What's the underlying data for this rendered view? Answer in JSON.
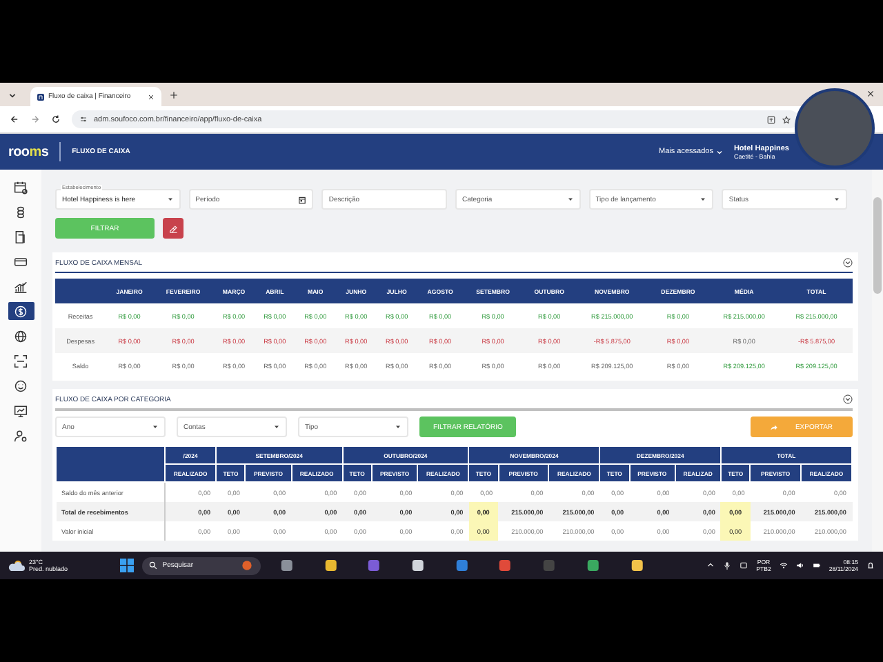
{
  "browser": {
    "tab_title": "Fluxo de caixa | Financeiro",
    "url": "adm.soufoco.com.br/financeiro/app/fluxo-de-caixa"
  },
  "header": {
    "logo": [
      {
        "text": "roo",
        "accent": false
      },
      {
        "text": "m",
        "accent": true
      },
      {
        "text": "s",
        "accent": false
      }
    ],
    "title": "FLUXO DE CAIXA",
    "menu": "Mais acessados",
    "hotel": "Hotel Happines",
    "location": "Caetité - Bahia"
  },
  "sidebar": {
    "items": [
      {
        "kind": "calendar",
        "selected": false
      },
      {
        "kind": "coins",
        "selected": false
      },
      {
        "kind": "document",
        "selected": false
      },
      {
        "kind": "card",
        "selected": false
      },
      {
        "kind": "chart",
        "selected": false
      },
      {
        "kind": "dollar",
        "selected": true
      },
      {
        "kind": "globe",
        "selected": false
      },
      {
        "kind": "scan",
        "selected": false
      },
      {
        "kind": "smile",
        "selected": false
      },
      {
        "kind": "monitor",
        "selected": false
      },
      {
        "kind": "user",
        "selected": false
      }
    ]
  },
  "filters": [
    {
      "kind": "select",
      "label": "Estabelecimento",
      "value": "Hotel Happiness is here"
    },
    {
      "kind": "date",
      "placeholder": "Período"
    },
    {
      "kind": "text",
      "placeholder": "Descrição"
    },
    {
      "kind": "select",
      "placeholder": "Categoria"
    },
    {
      "kind": "select",
      "placeholder": "Tipo de lançamento"
    },
    {
      "kind": "select",
      "placeholder": "Status"
    }
  ],
  "filter_button": "FILTRAR",
  "monthly": {
    "title": "FLUXO DE CAIXA MENSAL",
    "columns": [
      "JANEIRO",
      "FEVEREIRO",
      "MARÇO",
      "ABRIL",
      "MAIO",
      "JUNHO",
      "JULHO",
      "AGOSTO",
      "SETEMBRO",
      "OUTUBRO",
      "NOVEMBRO",
      "DEZEMBRO",
      "MÉDIA",
      "TOTAL"
    ],
    "rows": [
      {
        "label": "Receitas",
        "cells": [
          {
            "text": "R$ 0,00",
            "kind": "positive"
          },
          {
            "text": "R$ 0,00",
            "kind": "positive"
          },
          {
            "text": "R$ 0,00",
            "kind": "positive"
          },
          {
            "text": "R$ 0,00",
            "kind": "positive"
          },
          {
            "text": "R$ 0,00",
            "kind": "positive"
          },
          {
            "text": "R$ 0,00",
            "kind": "positive"
          },
          {
            "text": "R$ 0,00",
            "kind": "positive"
          },
          {
            "text": "R$ 0,00",
            "kind": "positive"
          },
          {
            "text": "R$ 0,00",
            "kind": "positive"
          },
          {
            "text": "R$ 0,00",
            "kind": "positive"
          },
          {
            "text": "R$ 215.000,00",
            "kind": "positive"
          },
          {
            "text": "R$ 0,00",
            "kind": "positive"
          },
          {
            "text": "R$ 215.000,00",
            "kind": "positive"
          },
          {
            "text": "R$ 215.000,00",
            "kind": "positive"
          }
        ]
      },
      {
        "label": "Despesas",
        "cells": [
          {
            "text": "R$ 0,00",
            "kind": "negative"
          },
          {
            "text": "R$ 0,00",
            "kind": "negative"
          },
          {
            "text": "R$ 0,00",
            "kind": "negative"
          },
          {
            "text": "R$ 0,00",
            "kind": "negative"
          },
          {
            "text": "R$ 0,00",
            "kind": "negative"
          },
          {
            "text": "R$ 0,00",
            "kind": "negative"
          },
          {
            "text": "R$ 0,00",
            "kind": "negative"
          },
          {
            "text": "R$ 0,00",
            "kind": "negative"
          },
          {
            "text": "R$ 0,00",
            "kind": "negative"
          },
          {
            "text": "R$ 0,00",
            "kind": "negative"
          },
          {
            "text": "-R$ 5.875,00",
            "kind": "negative"
          },
          {
            "text": "R$ 0,00",
            "kind": "negative"
          },
          {
            "text": "R$ 0,00",
            "kind": "neutral"
          },
          {
            "text": "-R$ 5.875,00",
            "kind": "negative"
          }
        ]
      },
      {
        "label": "Saldo",
        "cells": [
          {
            "text": "R$ 0,00",
            "kind": "neutral"
          },
          {
            "text": "R$ 0,00",
            "kind": "neutral"
          },
          {
            "text": "R$ 0,00",
            "kind": "neutral"
          },
          {
            "text": "R$ 0,00",
            "kind": "neutral"
          },
          {
            "text": "R$ 0,00",
            "kind": "neutral"
          },
          {
            "text": "R$ 0,00",
            "kind": "neutral"
          },
          {
            "text": "R$ 0,00",
            "kind": "neutral"
          },
          {
            "text": "R$ 0,00",
            "kind": "neutral"
          },
          {
            "text": "R$ 0,00",
            "kind": "neutral"
          },
          {
            "text": "R$ 0,00",
            "kind": "neutral"
          },
          {
            "text": "R$ 209.125,00",
            "kind": "neutral"
          },
          {
            "text": "R$ 0,00",
            "kind": "neutral"
          },
          {
            "text": "R$ 209.125,00",
            "kind": "positive"
          },
          {
            "text": "R$ 209.125,00",
            "kind": "positive"
          }
        ]
      }
    ]
  },
  "category": {
    "title": "FLUXO DE CAIXA POR CATEGORIA",
    "filters": [
      {
        "placeholder": "Ano"
      },
      {
        "placeholder": "Contas"
      },
      {
        "placeholder": "Tipo"
      }
    ],
    "filter_button": "FILTRAR RELATÓRIO",
    "export_button": "EXPORTAR",
    "groups": [
      {
        "label": "/2024",
        "subcolumns": [
          "REALIZADO"
        ]
      },
      {
        "label": "SETEMBRO/2024",
        "subcolumns": [
          "TETO",
          "PREVISTO",
          "REALIZADO"
        ]
      },
      {
        "label": "OUTUBRO/2024",
        "subcolumns": [
          "TETO",
          "PREVISTO",
          "REALIZADO"
        ]
      },
      {
        "label": "NOVEMBRO/2024",
        "subcolumns": [
          "TETO",
          "PREVISTO",
          "REALIZADO"
        ]
      },
      {
        "label": "DEZEMBRO/2024",
        "subcolumns": [
          "TETO",
          "PREVISTO",
          "REALIZAD"
        ]
      },
      {
        "label": "TOTAL",
        "subcolumns": [
          "TETO",
          "PREVISTO",
          "REALIZADO"
        ]
      }
    ],
    "rows": [
      {
        "label": "Saldo do mês anterior",
        "bold": false,
        "cells": [
          {
            "text": "0,00",
            "highlighted": false
          },
          {
            "text": "0,00",
            "highlighted": false
          },
          {
            "text": "0,00",
            "highlighted": false
          },
          {
            "text": "0,00",
            "highlighted": false
          },
          {
            "text": "0,00",
            "highlighted": false
          },
          {
            "text": "0,00",
            "highlighted": false
          },
          {
            "text": "0,00",
            "highlighted": false
          },
          {
            "text": "0,00",
            "highlighted": false
          },
          {
            "text": "0,00",
            "highlighted": false
          },
          {
            "text": "0,00",
            "highlighted": false
          },
          {
            "text": "0,00",
            "highlighted": false
          },
          {
            "text": "0,00",
            "highlighted": false
          },
          {
            "text": "0,00",
            "highlighted": false
          },
          {
            "text": "0,00",
            "highlighted": false
          },
          {
            "text": "0,00",
            "highlighted": false
          },
          {
            "text": "0,00",
            "highlighted": false
          }
        ]
      },
      {
        "label": "Total de recebimentos",
        "bold": true,
        "cells": [
          {
            "text": "0,00",
            "highlighted": false
          },
          {
            "text": "0,00",
            "highlighted": false
          },
          {
            "text": "0,00",
            "highlighted": false
          },
          {
            "text": "0,00",
            "highlighted": false
          },
          {
            "text": "0,00",
            "highlighted": false
          },
          {
            "text": "0,00",
            "highlighted": false
          },
          {
            "text": "0,00",
            "highlighted": false
          },
          {
            "text": "0,00",
            "highlighted": true
          },
          {
            "text": "215.000,00",
            "highlighted": false
          },
          {
            "text": "215.000,00",
            "highlighted": false
          },
          {
            "text": "0,00",
            "highlighted": false
          },
          {
            "text": "0,00",
            "highlighted": false
          },
          {
            "text": "0,00",
            "highlighted": false
          },
          {
            "text": "0,00",
            "highlighted": true
          },
          {
            "text": "215.000,00",
            "highlighted": false
          },
          {
            "text": "215.000,00",
            "highlighted": false
          }
        ]
      },
      {
        "label": "Valor inicial",
        "bold": false,
        "cells": [
          {
            "text": "0,00",
            "highlighted": false
          },
          {
            "text": "0,00",
            "highlighted": false
          },
          {
            "text": "0,00",
            "highlighted": false
          },
          {
            "text": "0,00",
            "highlighted": false
          },
          {
            "text": "0,00",
            "highlighted": false
          },
          {
            "text": "0,00",
            "highlighted": false
          },
          {
            "text": "0,00",
            "highlighted": false
          },
          {
            "text": "0,00",
            "highlighted": true
          },
          {
            "text": "210.000,00",
            "highlighted": false
          },
          {
            "text": "210.000,00",
            "highlighted": false
          },
          {
            "text": "0,00",
            "highlighted": false
          },
          {
            "text": "0,00",
            "highlighted": false
          },
          {
            "text": "0,00",
            "highlighted": false
          },
          {
            "text": "0,00",
            "highlighted": true
          },
          {
            "text": "210.000,00",
            "highlighted": false
          },
          {
            "text": "210.000,00",
            "highlighted": false
          }
        ]
      }
    ]
  },
  "taskbar": {
    "weather_temp": "23°C",
    "weather_text": "Pred. nublado",
    "search": "Pesquisar",
    "language": [
      "POR",
      "PTB2"
    ],
    "time": "08:15",
    "date": "28/11/2024"
  }
}
